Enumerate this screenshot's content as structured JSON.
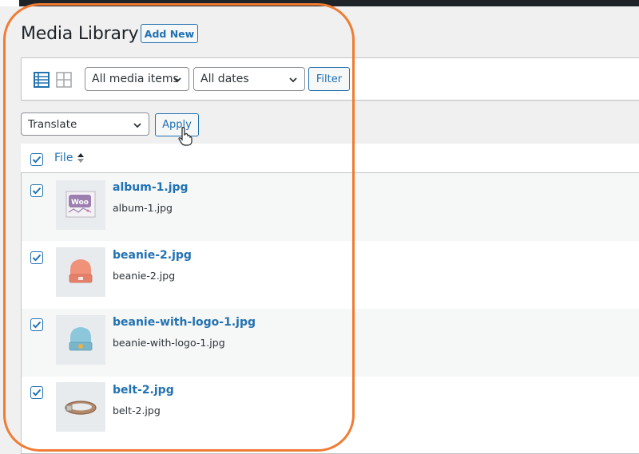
{
  "header": {
    "title": "Media Library",
    "add_new_label": "Add New"
  },
  "filters": {
    "media_type_value": "All media items",
    "date_value": "All dates",
    "filter_label": "Filter"
  },
  "bulk": {
    "action_value": "Translate",
    "apply_label": "Apply"
  },
  "table": {
    "column_file": "File",
    "rows": [
      {
        "title": "album-1.jpg",
        "filename": "album-1.jpg",
        "checked": true,
        "thumb_icon": "woo-album-thumbnail"
      },
      {
        "title": "beanie-2.jpg",
        "filename": "beanie-2.jpg",
        "checked": true,
        "thumb_icon": "orange-beanie-thumbnail"
      },
      {
        "title": "beanie-with-logo-1.jpg",
        "filename": "beanie-with-logo-1.jpg",
        "checked": true,
        "thumb_icon": "blue-beanie-thumbnail"
      },
      {
        "title": "belt-2.jpg",
        "filename": "belt-2.jpg",
        "checked": true,
        "thumb_icon": "belt-thumbnail"
      }
    ]
  },
  "colors": {
    "accent": "#2271b1",
    "highlight": "#f07c33",
    "background": "#f0f0f1"
  }
}
